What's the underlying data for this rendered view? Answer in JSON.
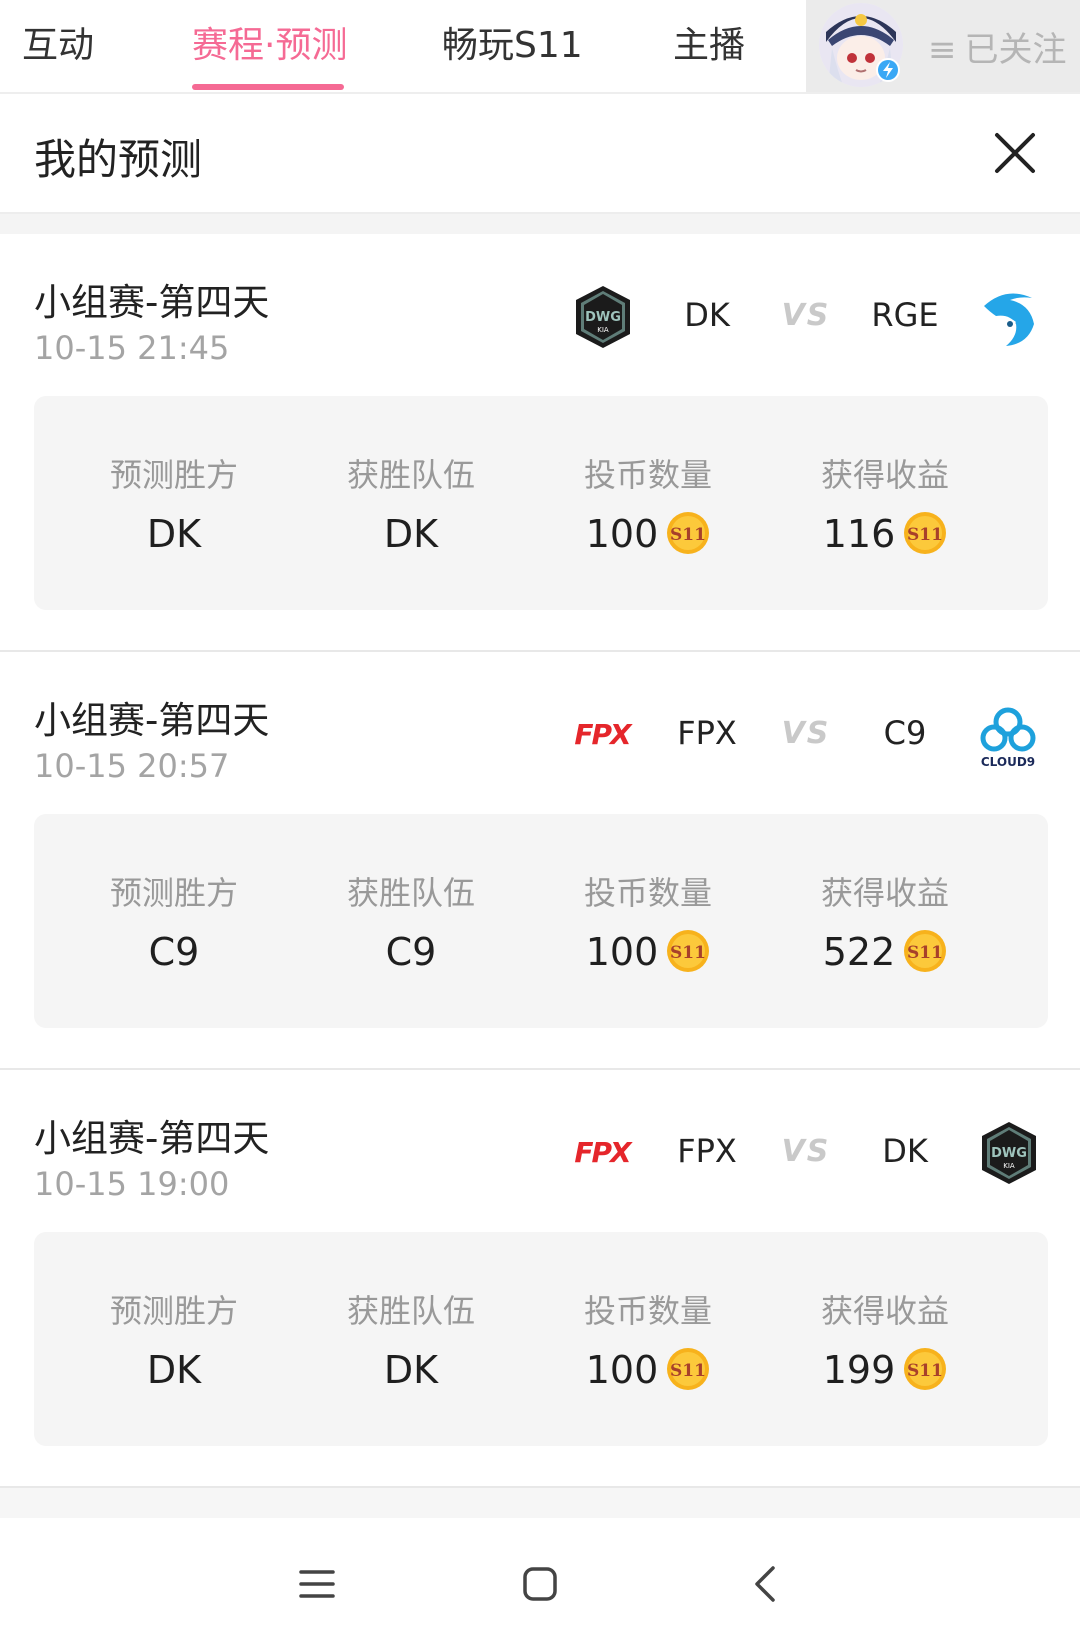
{
  "tabs": [
    {
      "label": "互动",
      "active": false
    },
    {
      "label": "赛程·预测",
      "active": true
    },
    {
      "label": "畅玩S11",
      "active": false
    },
    {
      "label": "主播",
      "active": false
    }
  ],
  "follow": {
    "menu_glyph": "≡",
    "label": "已关注"
  },
  "panel": {
    "title": "我的预测",
    "close_icon": "close-icon"
  },
  "stat_labels": {
    "predicted": "预测胜方",
    "winner": "获胜队伍",
    "stake": "投币数量",
    "earnings": "获得收益"
  },
  "vs_label": "VS",
  "coin_icon": "s11-coin-icon",
  "matches": [
    {
      "stage": "小组赛-第四天",
      "time": "10-15 21:45",
      "team_left": "DK",
      "team_right": "RGE",
      "predicted": "DK",
      "winner": "DK",
      "stake": "100",
      "earnings": "116"
    },
    {
      "stage": "小组赛-第四天",
      "time": "10-15 20:57",
      "team_left": "FPX",
      "team_right": "C9",
      "predicted": "C9",
      "winner": "C9",
      "stake": "100",
      "earnings": "522"
    },
    {
      "stage": "小组赛-第四天",
      "time": "10-15 19:00",
      "team_left": "FPX",
      "team_right": "DK",
      "predicted": "DK",
      "winner": "DK",
      "stake": "100",
      "earnings": "199"
    }
  ],
  "colors": {
    "accent": "#f56a94",
    "coin": "#f7b21c",
    "coin_text": "#a8402a",
    "fpx_red": "#e5262b",
    "rge_blue": "#25a6e8",
    "c9_blue": "#1ea1dc"
  }
}
